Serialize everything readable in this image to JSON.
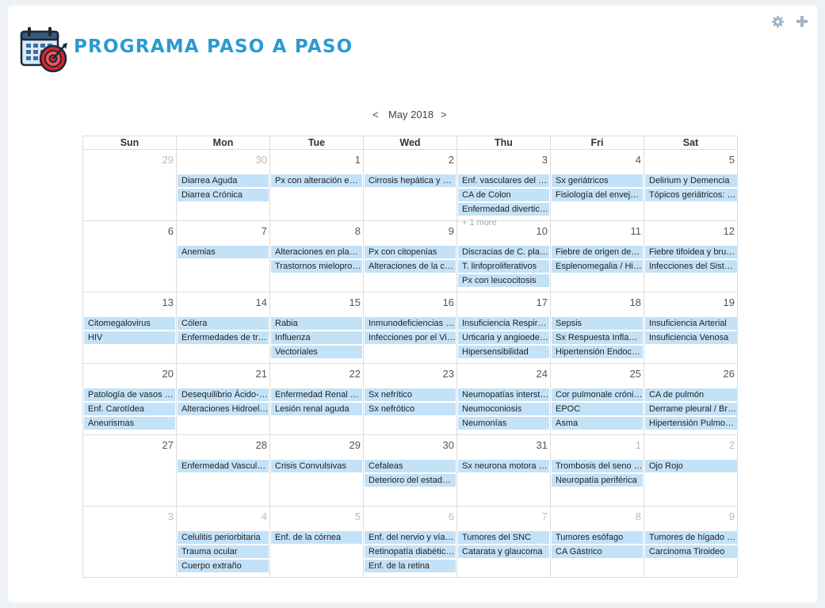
{
  "header": {
    "title": "PROGRAMA PASO A PASO",
    "logo_icon": "calendar-target-icon"
  },
  "toolbar": {
    "settings_icon": "gear-icon",
    "add_icon": "plus-icon"
  },
  "nav": {
    "prev": "<",
    "month": "May 2018",
    "next": ">"
  },
  "colors": {
    "accent": "#2a9bd1",
    "event_bg": "#c4e2f7"
  },
  "weekdays": [
    "Sun",
    "Mon",
    "Tue",
    "Wed",
    "Thu",
    "Fri",
    "Sat"
  ],
  "weeks": [
    {
      "days": [
        {
          "num": "29",
          "other": true,
          "events": []
        },
        {
          "num": "30",
          "other": true,
          "events": [
            "Diarrea Aguda",
            "Diarrea Crónica"
          ]
        },
        {
          "num": "1",
          "events": [
            "Px con alteración en la micción"
          ]
        },
        {
          "num": "2",
          "events": [
            "Cirrosis hepática y complicaciones"
          ]
        },
        {
          "num": "3",
          "events": [
            "Enf. vasculares del hígado",
            "CA de Colon",
            "Enfermedad diverticular"
          ],
          "more": "+ 1 more"
        },
        {
          "num": "4",
          "events": [
            "Sx geriátricos",
            "Fisiología del envejecimiento"
          ]
        },
        {
          "num": "5",
          "events": [
            "Delirium y Demencia",
            "Tópicos geriátricos: Polifarmacia"
          ]
        }
      ]
    },
    {
      "days": [
        {
          "num": "6",
          "events": []
        },
        {
          "num": "7",
          "events": [
            "Anemias"
          ]
        },
        {
          "num": "8",
          "events": [
            "Alteraciones en plaquetas",
            "Trastornos mieloproliferativos"
          ]
        },
        {
          "num": "9",
          "events": [
            "Px con citopenias",
            "Alteraciones de la coagulación"
          ]
        },
        {
          "num": "10",
          "events": [
            "Discracias de C. plasmáticas",
            "T. linfoproliferativos",
            "Px con leucocitosis"
          ]
        },
        {
          "num": "11",
          "events": [
            "Fiebre de origen desconocido",
            "Esplenomegalia / Hiperesplenismo"
          ]
        },
        {
          "num": "12",
          "events": [
            "Fiebre tifoidea y brucelosis",
            "Infecciones del Sistema Nervioso"
          ]
        }
      ]
    },
    {
      "days": [
        {
          "num": "13",
          "events": [
            "Citomegalovirus",
            "HIV"
          ]
        },
        {
          "num": "14",
          "events": [
            "Cólera",
            "Enfermedades de transmisión sexual"
          ]
        },
        {
          "num": "15",
          "events": [
            "Rabia",
            "Influenza",
            "Vectoriales"
          ]
        },
        {
          "num": "16",
          "events": [
            "Inmunodeficiencias primarias",
            "Infecciones por el Virus del Papiloma"
          ]
        },
        {
          "num": "17",
          "events": [
            "Insuficiencia Respiratoria",
            "Urticaria y angioedema",
            "Hipersensibilidad"
          ]
        },
        {
          "num": "18",
          "events": [
            "Sepsis",
            "Sx Respuesta Inflamatoria",
            "Hipertensión Endocraneal"
          ]
        },
        {
          "num": "19",
          "events": [
            "Insuficiencia Arterial",
            "Insuficiencia Venosa"
          ]
        }
      ]
    },
    {
      "days": [
        {
          "num": "20",
          "events": [
            "Patología de vasos linfáticos",
            "Enf. Carotídea",
            "Aneurismas"
          ]
        },
        {
          "num": "21",
          "events": [
            "Desequilibrio Ácido-Base",
            "Alteraciones Hidroelectrolíticas"
          ]
        },
        {
          "num": "22",
          "events": [
            "Enfermedad Renal Crónica",
            "Lesión renal aguda"
          ]
        },
        {
          "num": "23",
          "events": [
            "Sx nefrítico",
            "Sx nefrótico"
          ]
        },
        {
          "num": "24",
          "events": [
            "Neumopatías intersticiales",
            "Neumoconiosis",
            "Neumonías"
          ]
        },
        {
          "num": "25",
          "events": [
            "Cor pulmonale crónico",
            "EPOC",
            "Asma"
          ]
        },
        {
          "num": "26",
          "events": [
            "CA de pulmón",
            "Derrame pleural / Broncoscopia",
            "Hipertensión Pulmonar"
          ]
        }
      ]
    },
    {
      "days": [
        {
          "num": "27",
          "events": []
        },
        {
          "num": "28",
          "events": [
            "Enfermedad Vascular Cerebral"
          ]
        },
        {
          "num": "29",
          "events": [
            "Crisis Convulsivas"
          ]
        },
        {
          "num": "30",
          "events": [
            "Cefaleas",
            "Deterioro del estado de alerta"
          ]
        },
        {
          "num": "31",
          "events": [
            "Sx neurona motora Superior"
          ]
        },
        {
          "num": "1",
          "other": true,
          "events": [
            "Trombosis del seno cavernoso",
            "Neuropatía periférica"
          ]
        },
        {
          "num": "2",
          "other": true,
          "events": [
            "Ojo Rojo"
          ]
        }
      ]
    },
    {
      "days": [
        {
          "num": "3",
          "other": true,
          "events": []
        },
        {
          "num": "4",
          "other": true,
          "events": [
            "Celulitis periorbitaria",
            "Trauma ocular",
            "Cuerpo extraño"
          ]
        },
        {
          "num": "5",
          "other": true,
          "events": [
            "Enf. de la córnea"
          ]
        },
        {
          "num": "6",
          "other": true,
          "events": [
            "Enf. del nervio y vías ópticas",
            "Retinopatía diabética e hipertensiva",
            "Enf. de la retina"
          ]
        },
        {
          "num": "7",
          "other": true,
          "events": [
            "Tumores del SNC",
            "Catarata y glaucoma"
          ]
        },
        {
          "num": "8",
          "other": true,
          "events": [
            "Tumores esófago",
            "CA Gástrico"
          ]
        },
        {
          "num": "9",
          "other": true,
          "events": [
            "Tumores de hígado y páncreas",
            "Carcinoma Tiroideo"
          ]
        }
      ]
    }
  ]
}
